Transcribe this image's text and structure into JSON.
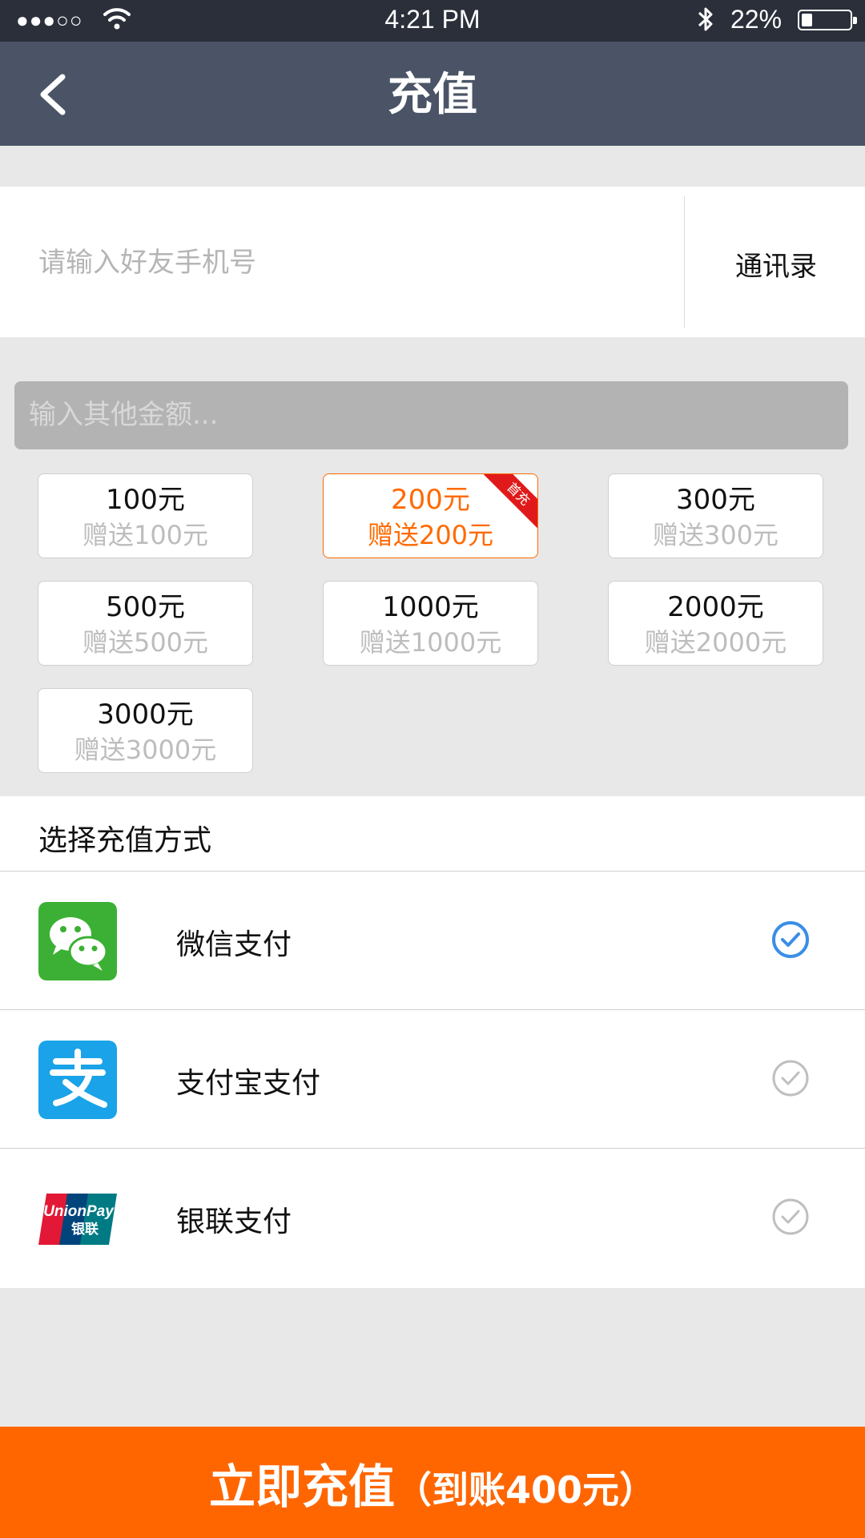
{
  "status_bar": {
    "signal": "●●●○○",
    "time": "4:21 PM",
    "battery": "22%",
    "battery_level": 0.22
  },
  "nav": {
    "title": "充值"
  },
  "recipient": {
    "placeholder": "请输入好友手机号",
    "value": "",
    "contacts_label": "通讯录"
  },
  "custom_amount": {
    "placeholder": "输入其他金额...",
    "value": ""
  },
  "options": [
    {
      "amount": "100元",
      "bonus": "赠送100元",
      "selected": false
    },
    {
      "amount": "200元",
      "bonus": "赠送200元",
      "selected": true,
      "ribbon": "首充"
    },
    {
      "amount": "300元",
      "bonus": "赠送300元",
      "selected": false
    },
    {
      "amount": "500元",
      "bonus": "赠送500元",
      "selected": false
    },
    {
      "amount": "1000元",
      "bonus": "赠送1000元",
      "selected": false
    },
    {
      "amount": "2000元",
      "bonus": "赠送2000元",
      "selected": false
    },
    {
      "amount": "3000元",
      "bonus": "赠送3000元",
      "selected": false
    }
  ],
  "payment": {
    "section_title": "选择充值方式",
    "methods": [
      {
        "label": "微信支付",
        "icon": "wechat-icon",
        "selected": true
      },
      {
        "label": "支付宝支付",
        "icon": "alipay-icon",
        "selected": false
      },
      {
        "label": "银联支付",
        "icon": "unionpay-icon",
        "selected": false,
        "logo_text_top": "UnionPay",
        "logo_text_bottom": "银联"
      }
    ]
  },
  "submit": {
    "label": "立即充值",
    "detail": "（到账400元）"
  },
  "colors": {
    "accent": "#ff6600",
    "nav_bg": "#4a5466",
    "status_bg": "#2a2f3a",
    "wechat": "#3cb034",
    "alipay": "#1aa3e8",
    "check_active": "#3a8ee6",
    "check_inactive": "#bfbfbf"
  }
}
